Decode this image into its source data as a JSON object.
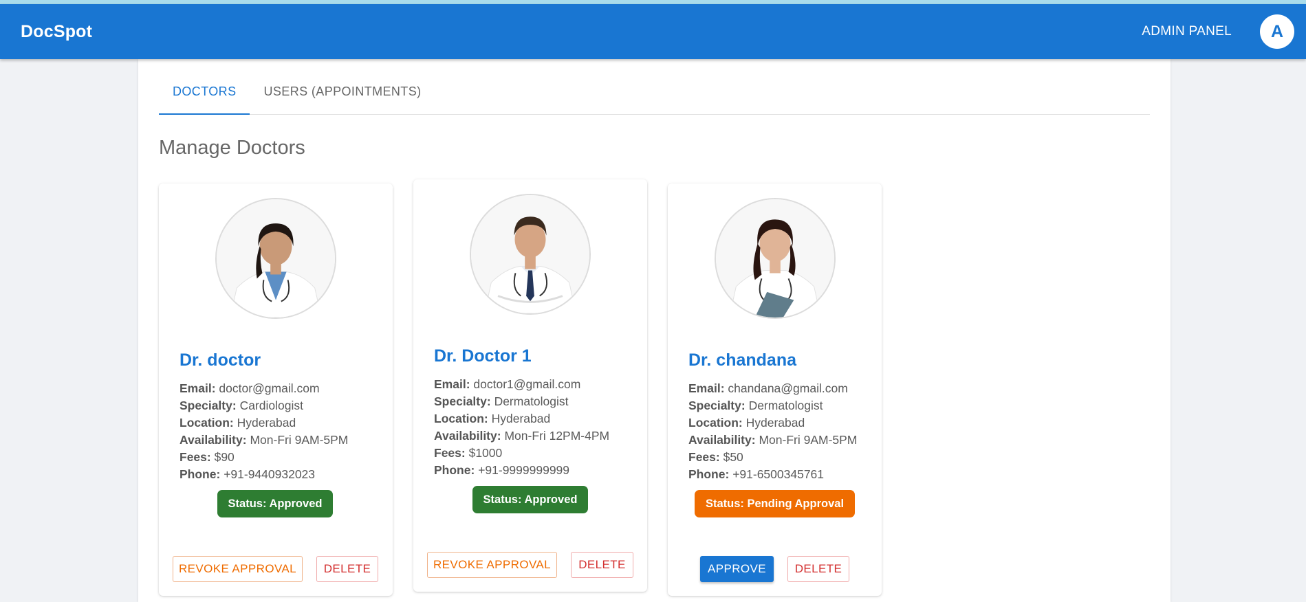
{
  "app": {
    "brand": "DocSpot",
    "admin_label": "ADMIN PANEL",
    "avatar_letter": "A"
  },
  "tabs": [
    {
      "label": "DOCTORS",
      "active": true
    },
    {
      "label": "USERS (APPOINTMENTS)",
      "active": false
    }
  ],
  "page_title": "Manage Doctors",
  "field_labels": {
    "email": "Email:",
    "specialty": "Specialty:",
    "location": "Location:",
    "availability": "Availability:",
    "fees": "Fees:",
    "phone": "Phone:"
  },
  "doctors": [
    {
      "name": "Dr. doctor",
      "email": "doctor@gmail.com",
      "specialty": "Cardiologist",
      "location": "Hyderabad",
      "availability": "Mon-Fri 9AM-5PM",
      "fees": "$90",
      "phone": "+91-9440932023",
      "status": "Status: Approved",
      "action_label": "REVOKE APPROVAL",
      "delete_label": "DELETE"
    },
    {
      "name": "Dr. Doctor 1",
      "email": "doctor1@gmail.com",
      "specialty": "Dermatologist",
      "location": "Hyderabad",
      "availability": "Mon-Fri 12PM-4PM",
      "fees": "$1000",
      "phone": "+91-9999999999",
      "status": "Status: Approved",
      "action_label": "REVOKE APPROVAL",
      "delete_label": "DELETE"
    },
    {
      "name": "Dr. chandana",
      "email": "chandana@gmail.com",
      "specialty": "Dermatologist",
      "location": "Hyderabad",
      "availability": "Mon-Fri 9AM-5PM",
      "fees": "$50",
      "phone": "+91-6500345761",
      "status": "Status: Pending Approval",
      "action_label": "APPROVE",
      "delete_label": "DELETE"
    }
  ],
  "colors": {
    "primary": "#1976d2",
    "approved": "#2e7d32",
    "pending": "#ef6c00",
    "danger": "#d32f2f"
  }
}
